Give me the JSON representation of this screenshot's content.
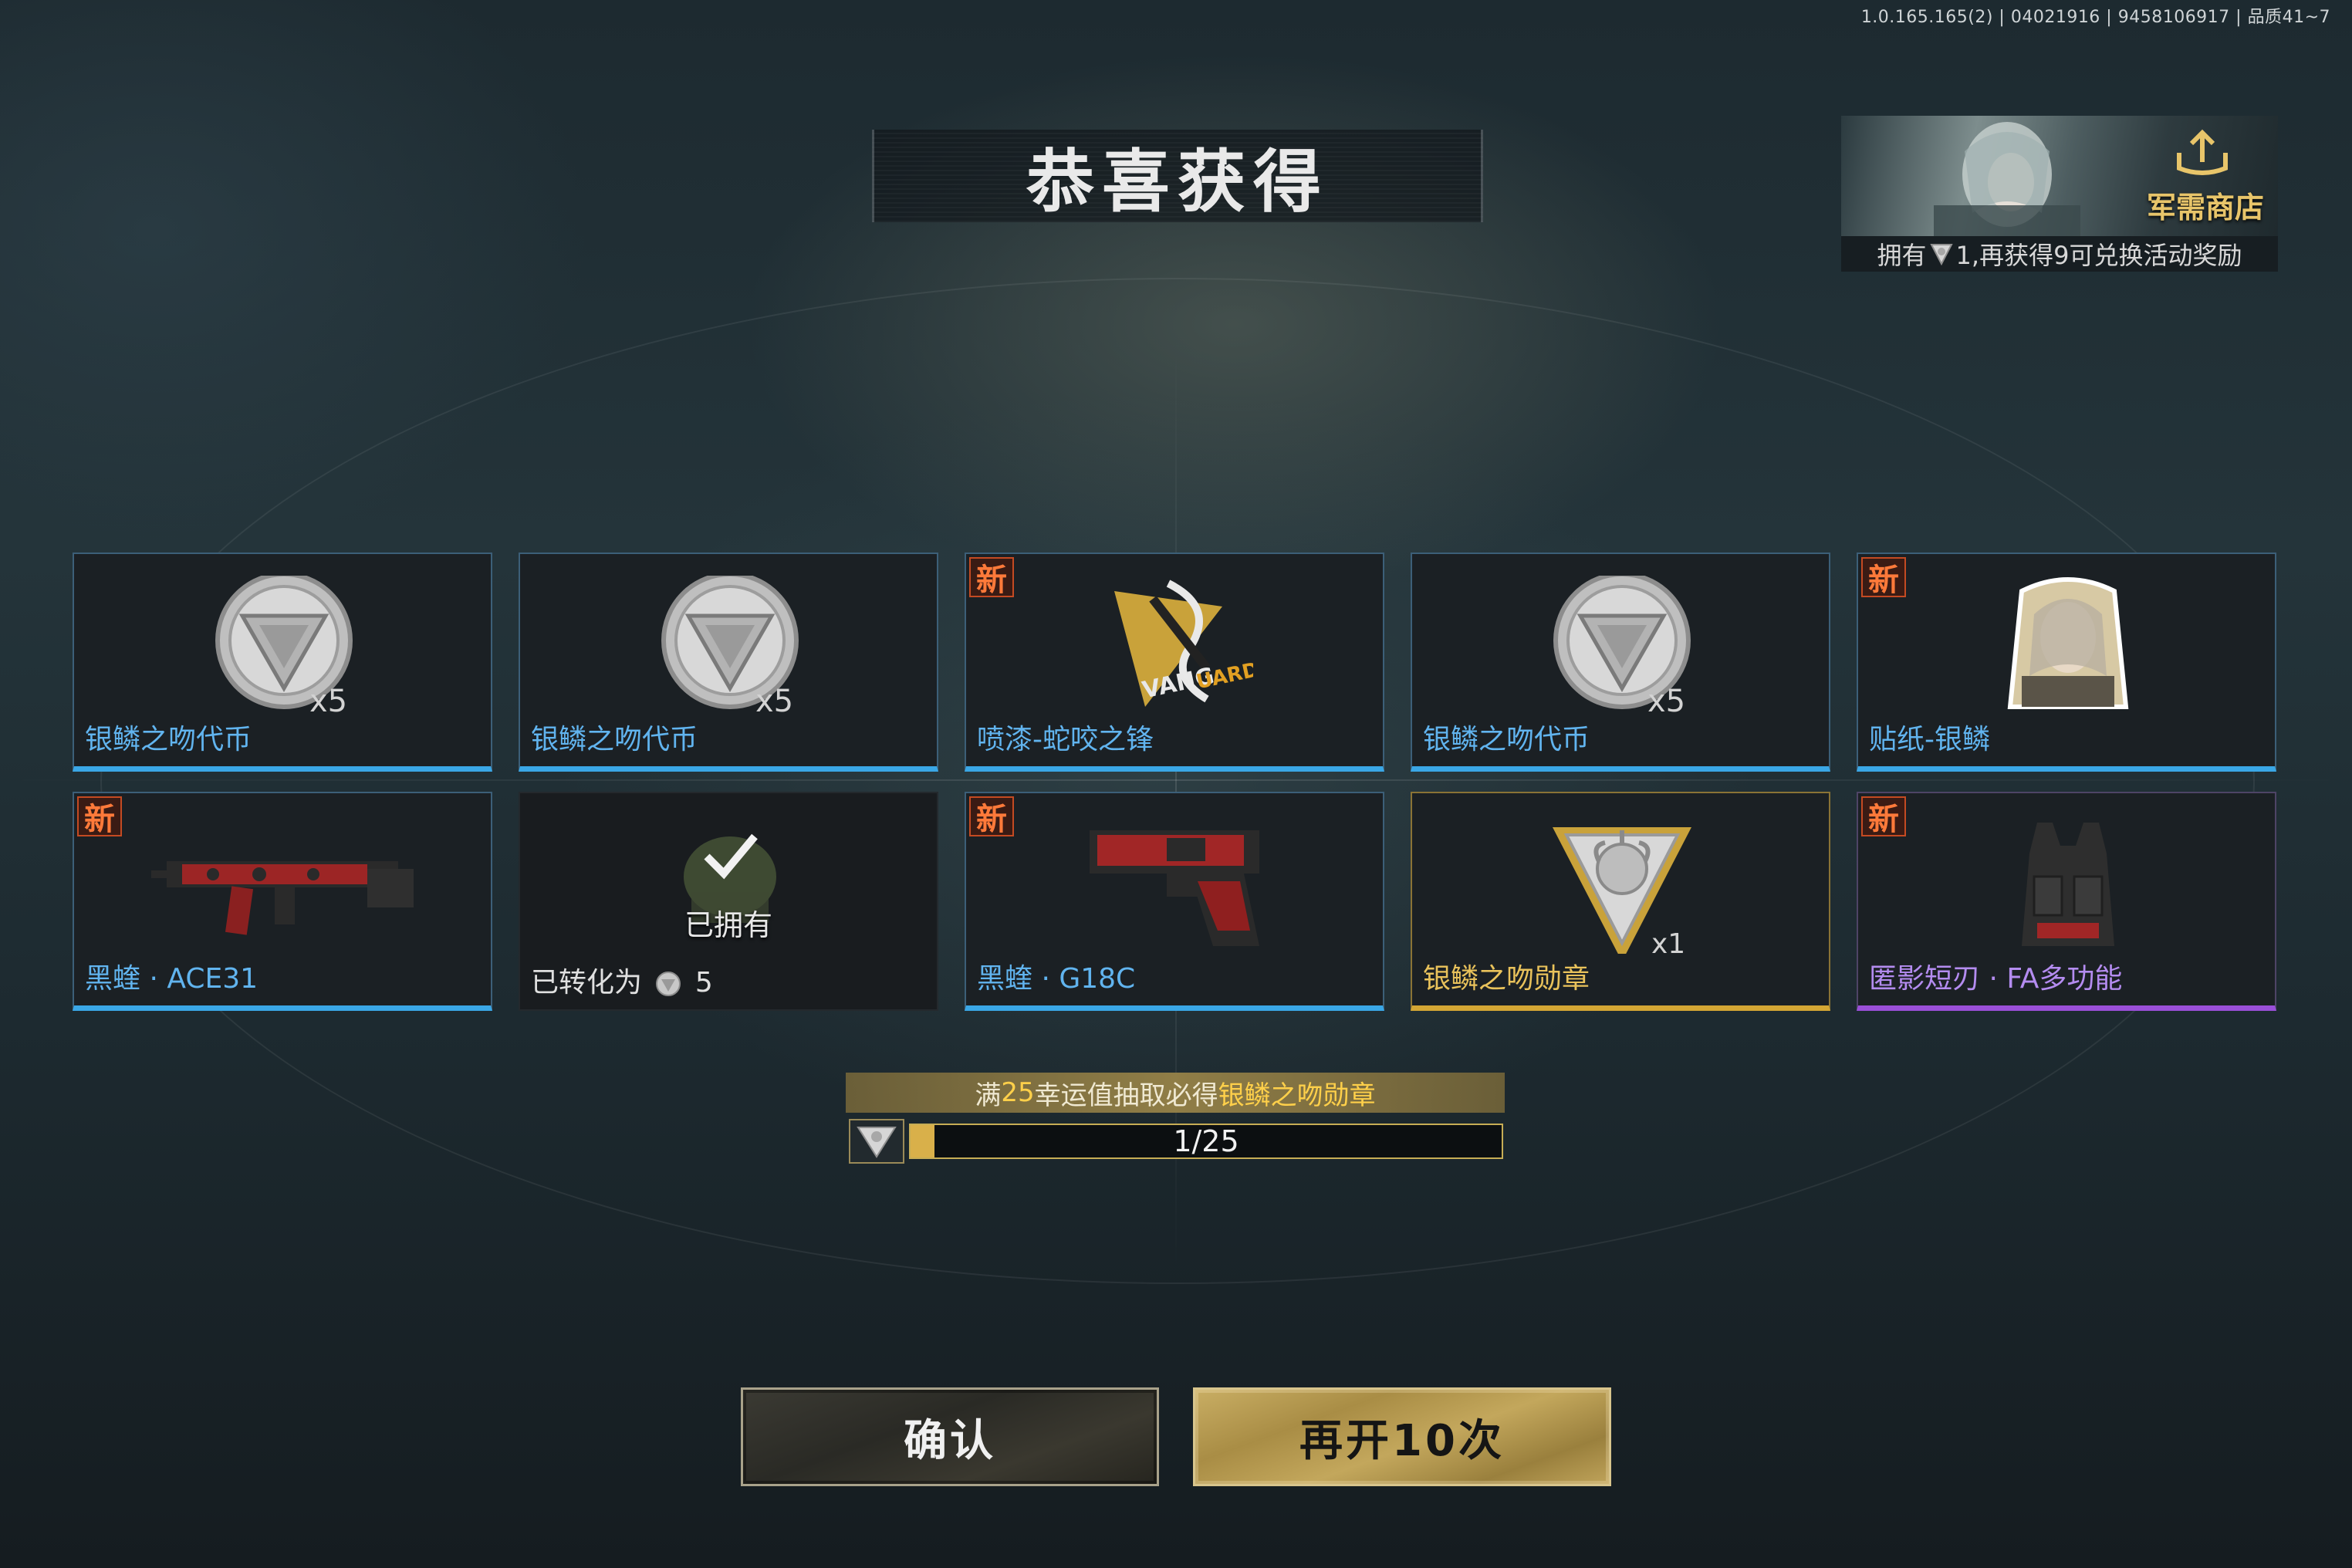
{
  "version_info": "1.0.165.165(2) | 04021916 | 9458106917 | 品质41~7",
  "title": "恭喜获得",
  "shop": {
    "label": "军需商店",
    "sub_prefix": "拥有",
    "sub_suffix": "1,再获得9可兑换活动奖励"
  },
  "rewards": [
    {
      "name": "银鳞之吻代币",
      "quantity": "x5",
      "is_new": false,
      "rarity": "blue",
      "art": "silver-coin"
    },
    {
      "name": "银鳞之吻代币",
      "quantity": "x5",
      "is_new": false,
      "rarity": "blue",
      "art": "silver-coin"
    },
    {
      "name": "喷漆-蛇咬之锋",
      "quantity": "",
      "is_new": true,
      "new_label": "新",
      "rarity": "blue",
      "art": "spray-vanguard"
    },
    {
      "name": "银鳞之吻代币",
      "quantity": "x5",
      "is_new": false,
      "rarity": "blue",
      "art": "silver-coin"
    },
    {
      "name": "贴纸-银鳞",
      "quantity": "",
      "is_new": true,
      "new_label": "新",
      "rarity": "blue",
      "art": "sticker-portrait"
    },
    {
      "name": "黑蝰 · ACE31",
      "quantity": "",
      "is_new": true,
      "new_label": "新",
      "rarity": "blue",
      "art": "rifle"
    },
    {
      "name_prefix": "已转化为",
      "converted_amount": "5",
      "owned_label": "已拥有",
      "is_new": false,
      "rarity": "owned",
      "art": "helmet"
    },
    {
      "name": "黑蝰 · G18C",
      "quantity": "",
      "is_new": true,
      "new_label": "新",
      "rarity": "blue",
      "art": "pistol"
    },
    {
      "name": "银鳞之吻勋章",
      "quantity": "x1",
      "is_new": false,
      "rarity": "gold",
      "art": "medal"
    },
    {
      "name": "匿影短刃 · FA多功能",
      "quantity": "",
      "is_new": true,
      "new_label": "新",
      "rarity": "purple",
      "art": "vest"
    }
  ],
  "pity": {
    "text_1": "满",
    "text_num": "25",
    "text_2": "幸运值抽取必得",
    "text_item": "银鳞之吻勋章",
    "progress_label": "1/25",
    "current": 1,
    "max": 25
  },
  "buttons": {
    "confirm": "确认",
    "reopen": "再开10次"
  },
  "colors": {
    "blue_rarity": "#3aa7e6",
    "gold_rarity": "#d4a634",
    "purple_rarity": "#9a4fd8",
    "new_badge": "#ff7a3a",
    "accent_gold": "#d9b04a"
  }
}
